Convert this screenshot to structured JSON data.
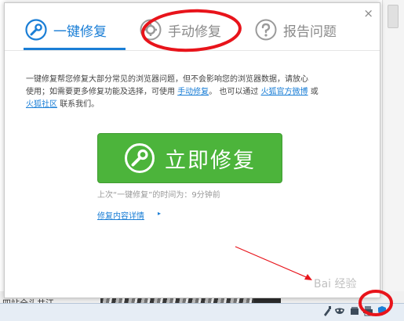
{
  "dialog": {
    "tabs": [
      {
        "label": "一键修复",
        "icon": "wrench-icon",
        "active": true
      },
      {
        "label": "手动修复",
        "icon": "gear-icon",
        "active": false
      },
      {
        "label": "报告问题",
        "icon": "question-icon",
        "active": false
      }
    ],
    "close_symbol": "×",
    "description": {
      "line1": "一键修复帮您修复大部分常见的浏览器问题，但不会影响您的浏览器数据，请放心",
      "line2_prefix": "使用；如需要更多修复功能及选择，可使用",
      "manual_link": "手动修复",
      "line2_middle": "。 也可以通过",
      "weibo_link": "火狐官方微博",
      "line2_suffix": "或",
      "community_link": "火狐社区",
      "line3_suffix": "联系我们。"
    },
    "fix_button_label": "立即修复",
    "last_repair": "上次“一键修复”的时间为：9分钟前",
    "details_link": "修复内容详情",
    "details_arrow": "▸"
  },
  "background": {
    "partial_text": "四站全头共江"
  },
  "tray_icons": [
    "plugin-icon",
    "mask-icon",
    "box-icon",
    "printer-icon",
    "shield-icon"
  ],
  "colors": {
    "accent_blue": "#1a7ed6",
    "button_green": "#4cb43b",
    "annotation_red": "#e8141b"
  },
  "watermark": "Bai 经验"
}
